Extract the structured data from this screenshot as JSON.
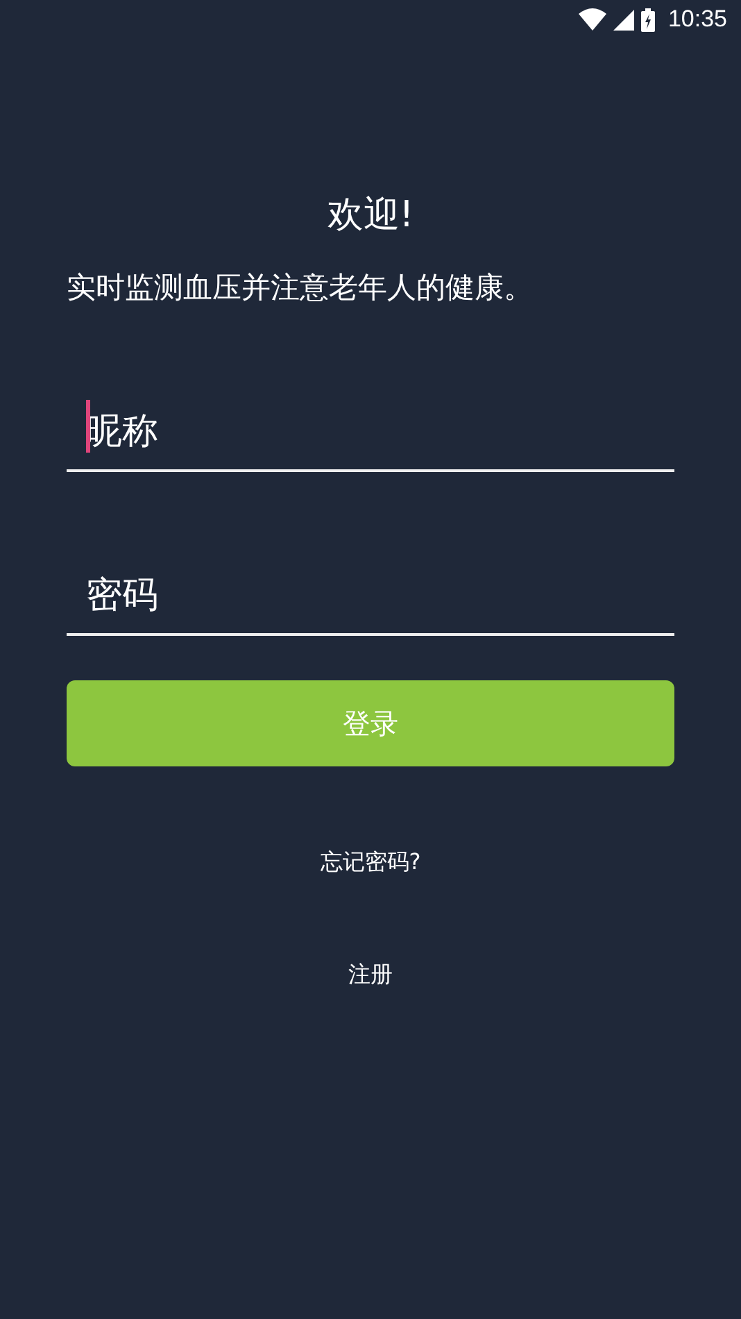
{
  "status_bar": {
    "time": "10:35"
  },
  "title": "欢迎!",
  "subtitle": "实时监测血压并注意老年人的健康。",
  "fields": [
    {
      "placeholder": "昵称",
      "focused": true
    },
    {
      "placeholder": "密码",
      "focused": false
    }
  ],
  "login_button": "登录",
  "forgot_link": "忘记密码?",
  "register_link": "注册"
}
